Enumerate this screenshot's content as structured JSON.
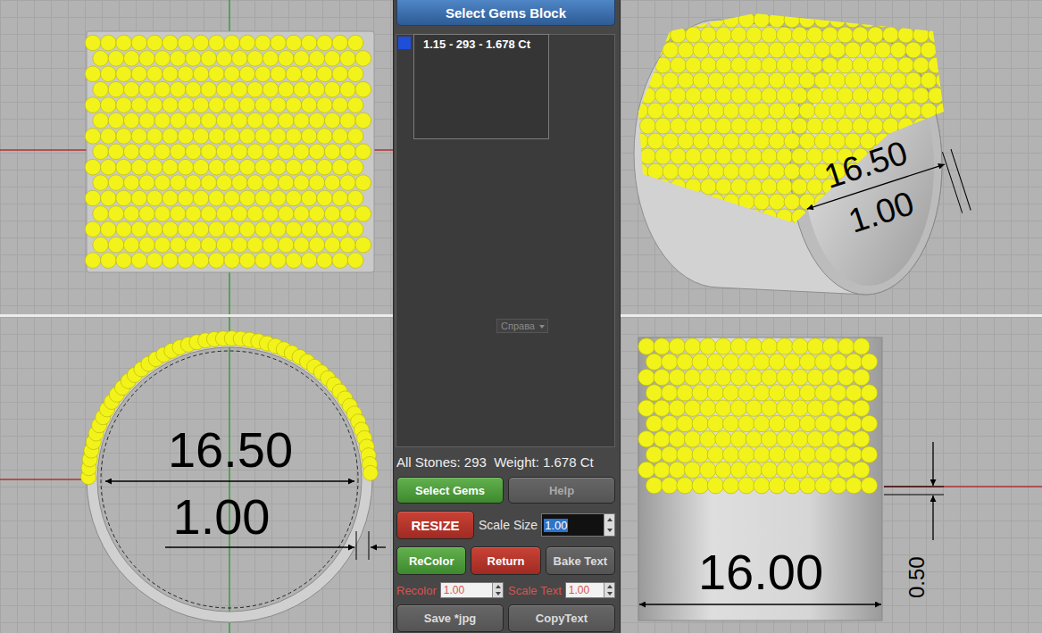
{
  "panel": {
    "title": "Select Gems Block",
    "gem_blocks": [
      {
        "label": "1.15 - 293 - 1.678 Ct",
        "color": "#1f4fd8",
        "selected": false
      }
    ],
    "background_label": "Справа",
    "summary": "All Stones: 293  Weight: 1.678 Ct",
    "rows": [
      [
        {
          "kind": "button",
          "label": "Select Gems",
          "tone": "green",
          "disabled": false
        },
        {
          "kind": "button",
          "label": "Help",
          "tone": "grey",
          "disabled": true
        }
      ],
      [
        {
          "kind": "button",
          "label": "RESIZE",
          "tone": "red",
          "disabled": false
        },
        {
          "kind": "field",
          "label": "Scale Size",
          "value": "1.00",
          "accent": false,
          "selected": true
        }
      ],
      [
        {
          "kind": "button",
          "label": "ReColor",
          "tone": "green",
          "disabled": false
        },
        {
          "kind": "button",
          "label": "Return",
          "tone": "red",
          "disabled": false
        },
        {
          "kind": "button",
          "label": "Bake Text",
          "tone": "grey",
          "disabled": false
        }
      ],
      [
        {
          "kind": "field",
          "label": "Recolor",
          "value": "1.00",
          "accent": true,
          "selected": false
        },
        {
          "kind": "field",
          "label": "Scale Text",
          "value": "1.00",
          "accent": true,
          "selected": false
        }
      ],
      [
        {
          "kind": "button",
          "label": "Save *jpg",
          "tone": "grey",
          "disabled": false
        },
        {
          "kind": "button",
          "label": "CopyText",
          "tone": "grey",
          "disabled": false
        }
      ]
    ]
  },
  "viewports": [
    {
      "kind": "top",
      "dimensions": []
    },
    {
      "kind": "perspective",
      "dimensions": [
        "16.50",
        "1.00"
      ]
    },
    {
      "kind": "front",
      "dimensions": [
        "16.50",
        "1.00"
      ]
    },
    {
      "kind": "right",
      "dimensions": [
        "16.00",
        "0.50"
      ]
    }
  ]
}
